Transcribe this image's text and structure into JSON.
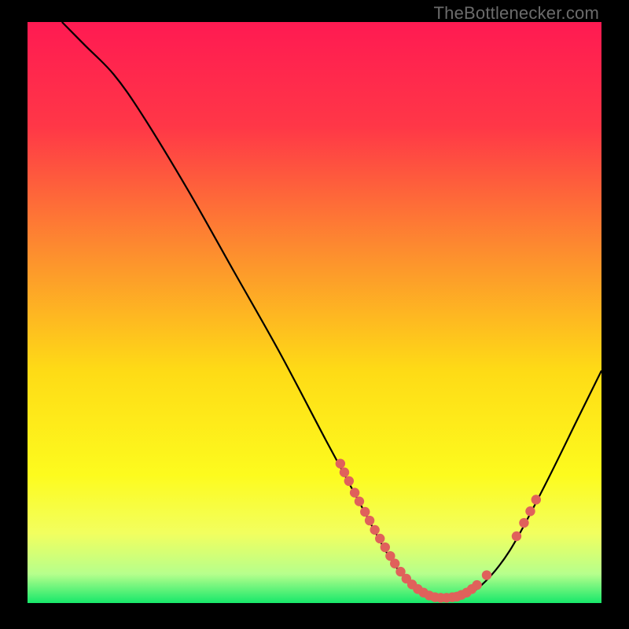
{
  "watermark": "TheBottlenecker.com",
  "chart_data": {
    "type": "line",
    "title": "",
    "xlabel": "",
    "ylabel": "",
    "xlim": [
      0,
      100
    ],
    "ylim": [
      0,
      100
    ],
    "gradient_stops": [
      {
        "offset": 0.0,
        "color": "#ff1a52"
      },
      {
        "offset": 0.18,
        "color": "#ff3747"
      },
      {
        "offset": 0.4,
        "color": "#fd8f2e"
      },
      {
        "offset": 0.6,
        "color": "#fedb16"
      },
      {
        "offset": 0.78,
        "color": "#fdfb1e"
      },
      {
        "offset": 0.88,
        "color": "#f2ff5f"
      },
      {
        "offset": 0.95,
        "color": "#b6ff8c"
      },
      {
        "offset": 1.0,
        "color": "#17e86a"
      }
    ],
    "curve": [
      {
        "x": 6,
        "y": 100
      },
      {
        "x": 10,
        "y": 96
      },
      {
        "x": 15,
        "y": 91
      },
      {
        "x": 20,
        "y": 84
      },
      {
        "x": 28,
        "y": 71
      },
      {
        "x": 36,
        "y": 57
      },
      {
        "x": 44,
        "y": 43
      },
      {
        "x": 52,
        "y": 28
      },
      {
        "x": 58,
        "y": 17
      },
      {
        "x": 63,
        "y": 8
      },
      {
        "x": 67,
        "y": 3
      },
      {
        "x": 71,
        "y": 1
      },
      {
        "x": 75,
        "y": 1
      },
      {
        "x": 79,
        "y": 3
      },
      {
        "x": 84,
        "y": 9
      },
      {
        "x": 90,
        "y": 20
      },
      {
        "x": 96,
        "y": 32
      },
      {
        "x": 100,
        "y": 40
      }
    ],
    "markers": [
      {
        "x": 54.5,
        "y": 24
      },
      {
        "x": 55.2,
        "y": 22.5
      },
      {
        "x": 56.0,
        "y": 21
      },
      {
        "x": 57.0,
        "y": 19
      },
      {
        "x": 57.8,
        "y": 17.5
      },
      {
        "x": 58.8,
        "y": 15.7
      },
      {
        "x": 59.6,
        "y": 14.2
      },
      {
        "x": 60.5,
        "y": 12.6
      },
      {
        "x": 61.4,
        "y": 11.1
      },
      {
        "x": 62.3,
        "y": 9.6
      },
      {
        "x": 63.2,
        "y": 8.1
      },
      {
        "x": 64.0,
        "y": 6.8
      },
      {
        "x": 65.0,
        "y": 5.4
      },
      {
        "x": 66.0,
        "y": 4.2
      },
      {
        "x": 67.0,
        "y": 3.2
      },
      {
        "x": 68.0,
        "y": 2.4
      },
      {
        "x": 69.0,
        "y": 1.8
      },
      {
        "x": 70.0,
        "y": 1.3
      },
      {
        "x": 71.0,
        "y": 1.0
      },
      {
        "x": 72.0,
        "y": 0.9
      },
      {
        "x": 73.0,
        "y": 0.9
      },
      {
        "x": 74.0,
        "y": 1.0
      },
      {
        "x": 74.8,
        "y": 1.1
      },
      {
        "x": 75.6,
        "y": 1.4
      },
      {
        "x": 76.5,
        "y": 1.8
      },
      {
        "x": 77.4,
        "y": 2.4
      },
      {
        "x": 78.3,
        "y": 3.1
      },
      {
        "x": 80.0,
        "y": 4.8
      },
      {
        "x": 85.2,
        "y": 11.5
      },
      {
        "x": 86.5,
        "y": 13.8
      },
      {
        "x": 87.6,
        "y": 15.8
      },
      {
        "x": 88.6,
        "y": 17.8
      }
    ],
    "marker_color": "#e0615b",
    "curve_color": "#000000"
  }
}
